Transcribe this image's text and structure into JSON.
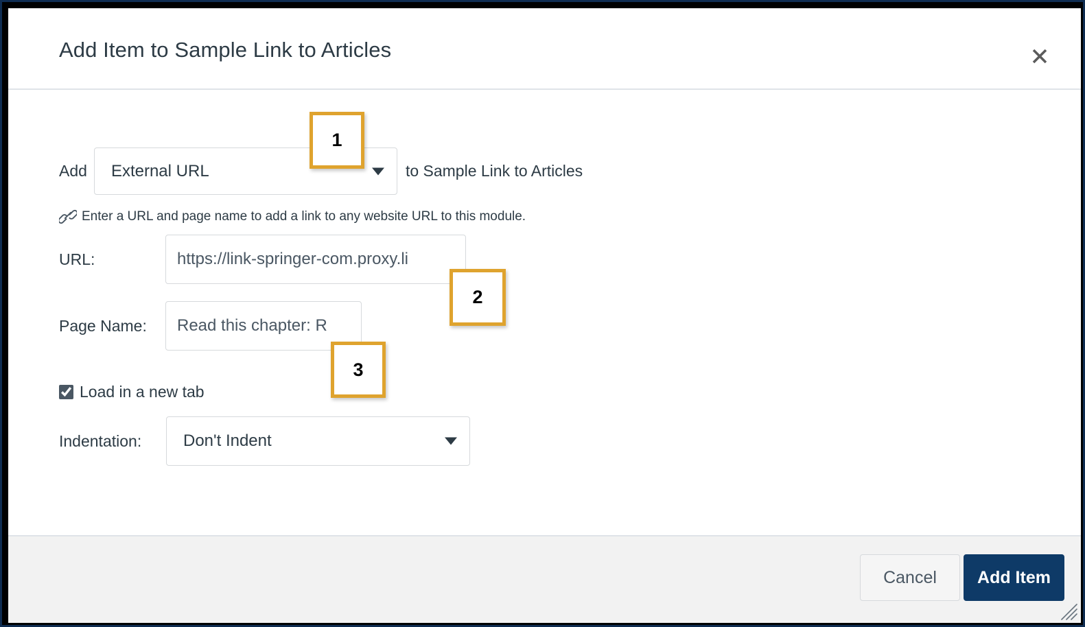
{
  "dialog": {
    "title": "Add Item to Sample Link to Articles",
    "close_icon": "close-icon"
  },
  "form": {
    "add_label": "Add",
    "type_select_value": "External URL",
    "type_select_options": [
      "External URL"
    ],
    "add_suffix": "to Sample Link to Articles",
    "help_icon": "link-icon",
    "help_text": "Enter a URL and page name to add a link to any website URL to this module.",
    "url_label": "URL:",
    "url_value": "https://link-springer-com.proxy.li",
    "url_placeholder": "",
    "pagename_label": "Page Name:",
    "pagename_value": "Read this chapter: R",
    "pagename_placeholder": "",
    "newtab_label": "Load in a new tab",
    "newtab_checked": true,
    "indent_label": "Indentation:",
    "indent_select_value": "Don't Indent",
    "indent_select_options": [
      "Don't Indent"
    ]
  },
  "footer": {
    "cancel_label": "Cancel",
    "add_item_label": "Add Item",
    "resize_grip_icon": "resize-grip-icon"
  },
  "callouts": [
    {
      "number": "1"
    },
    {
      "number": "2"
    },
    {
      "number": "3"
    }
  ],
  "colors": {
    "primary_button": "#0e3a67",
    "callout_border": "#dfa32e",
    "title_text": "#2d3b45",
    "footer_background": "#f2f2f2",
    "frame_navy": "#0f2d52",
    "frame_black": "#000000"
  }
}
